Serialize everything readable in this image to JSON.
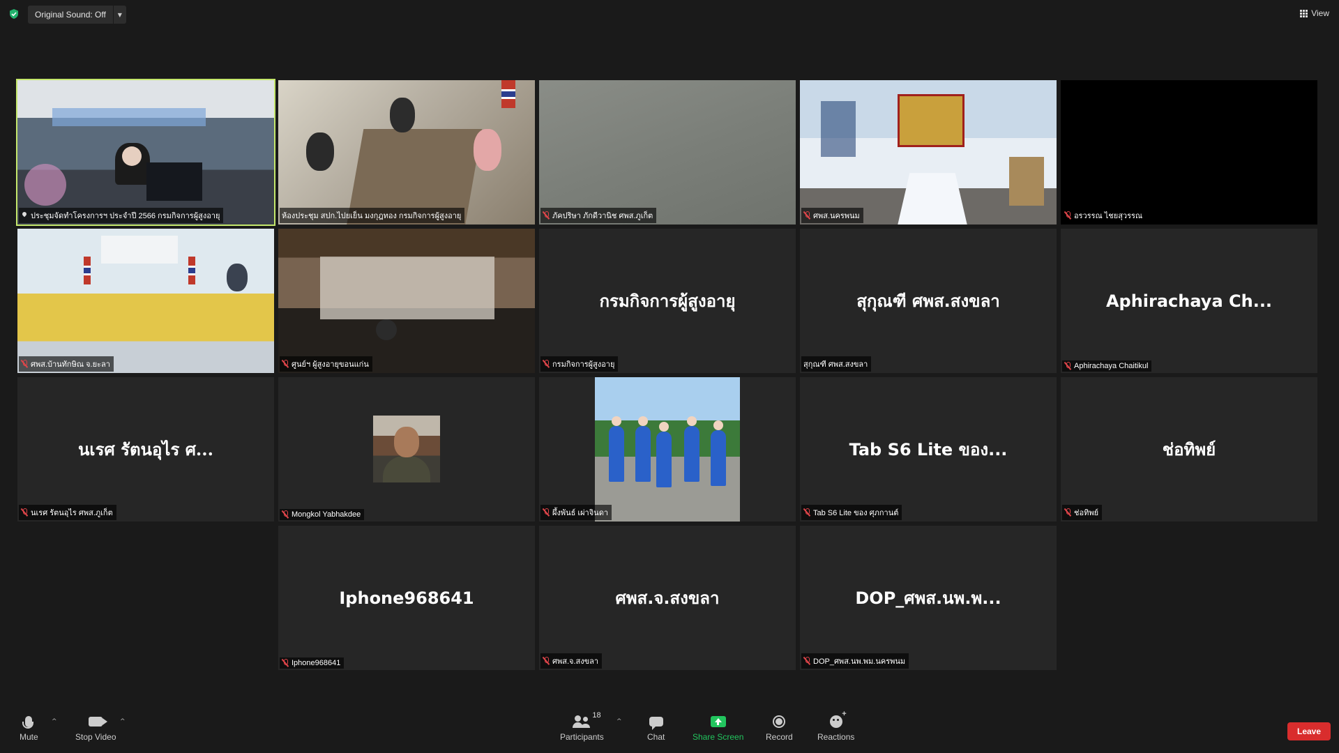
{
  "topbar": {
    "original_sound_label": "Original Sound: Off",
    "view_label": "View",
    "shield_color": "#23b26d"
  },
  "tiles": [
    {
      "name": "ประชุมจัดทำโครงการฯ ประจำปี 2566 กรมกิจการผู้สูงอายุ",
      "video": true,
      "active": true,
      "muted": false
    },
    {
      "name": "ห้องประชุม สปก.ไปยเย็น มงกุฎทอง กรมกิจการผู้สูงอายุ",
      "video": true,
      "muted": false
    },
    {
      "name": "ภัคปริษา ภักดีวานิช ศพส.ภูเก็ต",
      "video": true,
      "muted": true
    },
    {
      "name": "ศพส.นครพนม",
      "video": true,
      "muted": true
    },
    {
      "name": "อรวรรณ ไชยสุวรรณ",
      "video": true,
      "muted": true
    },
    {
      "name": "ศพส.บ้านทักษิณ จ.ยะลา",
      "video": true,
      "muted": true
    },
    {
      "name": "ศูนย์ฯ ผู้สูงอายุขอนแก่น",
      "video": true,
      "muted": true
    },
    {
      "name": "กรมกิจการผู้สูงอายุ",
      "display": "กรมกิจการผู้สูงอายุ",
      "video": false,
      "muted": true
    },
    {
      "name": "สุกุณฑี ศพส.สงขลา",
      "display": "สุกุณฑี ศพส.สงขลา",
      "video": false,
      "muted": false
    },
    {
      "name": "Aphirachaya Chaitikul",
      "display": "Aphirachaya  Ch...",
      "video": false,
      "muted": true
    },
    {
      "name": "นเรศ  รัตนอุไร  ศพส.ภูเก็ต",
      "display": "นเรศ  รัตนอุไร  ศ...",
      "video": false,
      "muted": true
    },
    {
      "name": "Mongkol Yabhakdee",
      "video": false,
      "avatar": true,
      "muted": true
    },
    {
      "name": "ผึ้งพันธ์ เผ่าจินดา",
      "video": false,
      "photo": true,
      "muted": true
    },
    {
      "name": "Tab S6 Lite ของ ศุภกานต์",
      "display": "Tab S6 Lite ของ...",
      "video": false,
      "muted": true
    },
    {
      "name": "ช่อทิพย์",
      "display": "ช่อทิพย์",
      "video": false,
      "muted": true
    },
    {
      "name": "Iphone968641",
      "display": "Iphone968641",
      "video": false,
      "muted": true
    },
    {
      "name": "ศพส.จ.สงขลา",
      "display": "ศพส.จ.สงขลา",
      "video": false,
      "muted": true
    },
    {
      "name": "DOP_ศพส.นพ.พม.นครพนม",
      "display": "DOP_ศพส.นพ.พ...",
      "video": false,
      "muted": true
    }
  ],
  "toolbar": {
    "mute": "Mute",
    "stop_video": "Stop Video",
    "participants": "Participants",
    "participants_count": "18",
    "chat": "Chat",
    "share_screen": "Share Screen",
    "record": "Record",
    "reactions": "Reactions",
    "leave": "Leave",
    "share_color": "#22c55e",
    "leave_color": "#d92d2d"
  }
}
